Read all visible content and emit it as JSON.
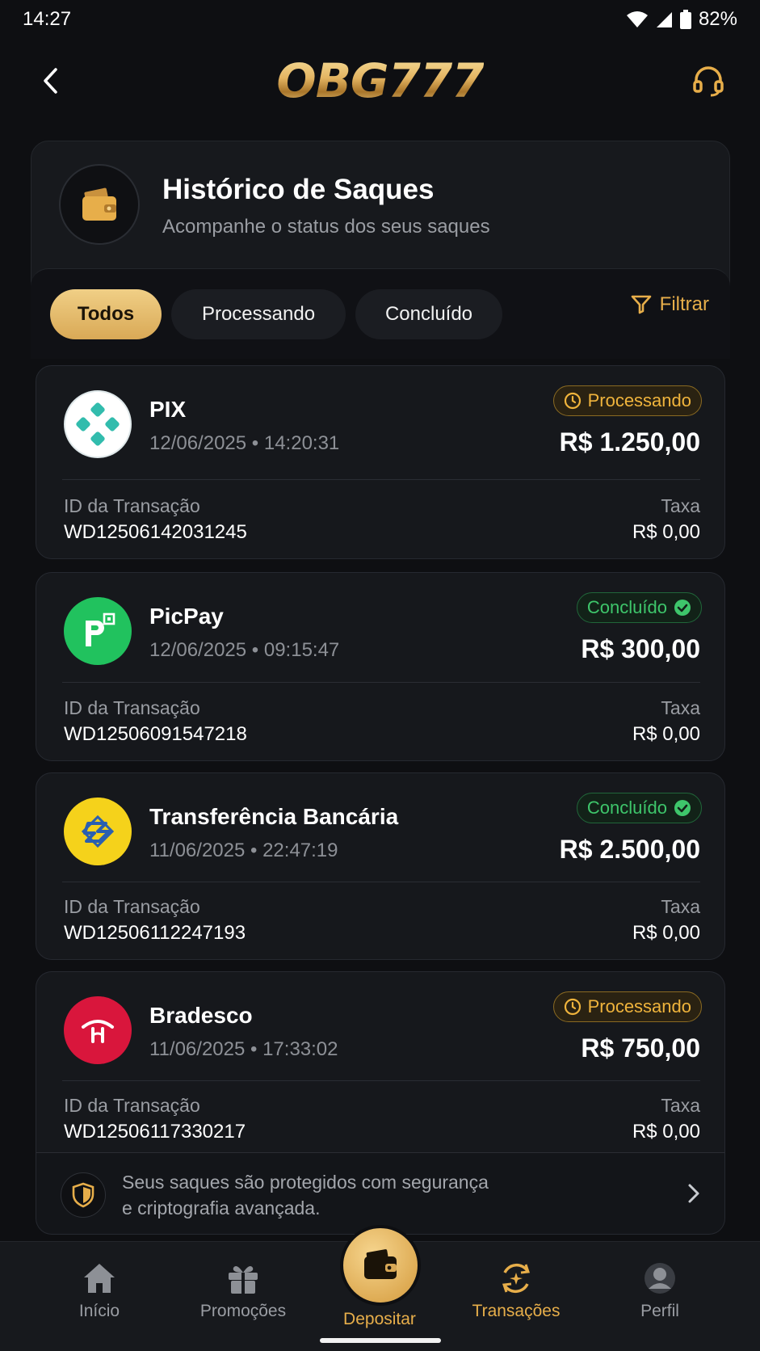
{
  "status_bar": {
    "time": "14:27",
    "battery": "82%"
  },
  "app": {
    "logo_text": "OBG777"
  },
  "header": {
    "title": "Histórico de Saques",
    "subtitle": "Acompanhe o status dos seus saques"
  },
  "tabs": [
    {
      "label": "Todos",
      "active": true
    },
    {
      "label": "Processando",
      "active": false
    },
    {
      "label": "Concluído",
      "active": false
    }
  ],
  "filter_label": "Filtrar",
  "withdrawals": [
    {
      "method": "PIX",
      "date": "12/06/2025 • 14:20:31",
      "status": "Processando",
      "amount": "R$ 1.250,00",
      "id_label": "ID da Transação",
      "id": "WD12506142031245",
      "fee_label": "Taxa",
      "fee": "R$ 0,00"
    },
    {
      "method": "PicPay",
      "date": "12/06/2025 • 09:15:47",
      "status": "Concluído",
      "amount": "R$ 300,00",
      "id_label": "ID da Transação",
      "id": "WD12506091547218",
      "fee_label": "Taxa",
      "fee": "R$ 0,00"
    },
    {
      "method": "Transferência Bancária",
      "date": "11/06/2025 • 22:47:19",
      "status": "Concluído",
      "amount": "R$ 2.500,00",
      "id_label": "ID da Transação",
      "id": "WD12506112247193",
      "fee_label": "Taxa",
      "fee": "R$ 0,00"
    },
    {
      "method": "Bradesco",
      "date": "11/06/2025 • 17:33:02",
      "status": "Processando",
      "amount": "R$ 750,00",
      "id_label": "ID da Transação",
      "id": "WD12506117330217",
      "fee_label": "Taxa",
      "fee": "R$ 0,00"
    }
  ],
  "security_note": {
    "line1": "Seus saques são protegidos com segurança",
    "line2": "e criptografia avançada."
  },
  "nav": [
    {
      "label": "Início",
      "icon": "home-icon"
    },
    {
      "label": "Promoções",
      "icon": "gift-icon"
    },
    {
      "label": "Depositar",
      "icon": "wallet-icon"
    },
    {
      "label": "Transações",
      "icon": "transactions-icon"
    },
    {
      "label": "Perfil",
      "icon": "profile-icon"
    }
  ],
  "colors": {
    "gold": "#e7ae4a",
    "processing": "#f0b43c",
    "done": "#3ec66b",
    "background": "#0e0f12",
    "pix": "#32bcad",
    "picpay": "#21c25e",
    "bb": "#f5d21b",
    "bradesco": "#d9163c"
  }
}
